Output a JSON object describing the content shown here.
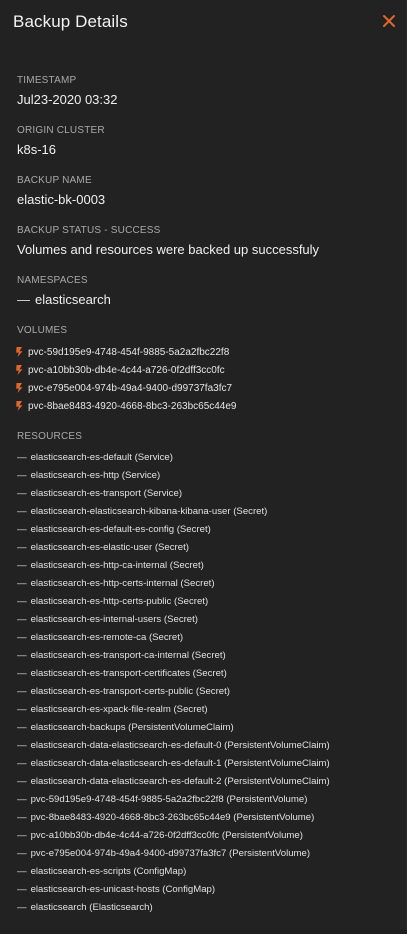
{
  "panel": {
    "title": "Backup Details",
    "close_label": "×"
  },
  "colors": {
    "background": "#222222",
    "accent": "#e0662b",
    "label": "#a9a9a9",
    "text": "#f0f0f0"
  },
  "timestamp": {
    "label": "TIMESTAMP",
    "value": "Jul23-2020 03:32"
  },
  "origin_cluster": {
    "label": "ORIGIN CLUSTER",
    "value": "k8s-16"
  },
  "backup_name": {
    "label": "BACKUP NAME",
    "value": "elastic-bk-0003"
  },
  "backup_status": {
    "label": "BACKUP STATUS - SUCCESS",
    "value": "Volumes and resources were backed up successfuly"
  },
  "namespaces": {
    "label": "NAMESPACES",
    "items": [
      "elasticsearch"
    ]
  },
  "volumes": {
    "label": "VOLUMES",
    "icon": "storage-volume-icon",
    "items": [
      "pvc-59d195e9-4748-454f-9885-5a2a2fbc22f8",
      "pvc-a10bb30b-db4e-4c44-a726-0f2dff3cc0fc",
      "pvc-e795e004-974b-49a4-9400-d99737fa3fc7",
      "pvc-8bae8483-4920-4668-8bc3-263bc65c44e9"
    ]
  },
  "resources": {
    "label": "RESOURCES",
    "items": [
      "elasticsearch-es-default (Service)",
      "elasticsearch-es-http (Service)",
      "elasticsearch-es-transport (Service)",
      "elasticsearch-elasticsearch-kibana-kibana-user (Secret)",
      "elasticsearch-es-default-es-config (Secret)",
      "elasticsearch-es-elastic-user (Secret)",
      "elasticsearch-es-http-ca-internal (Secret)",
      "elasticsearch-es-http-certs-internal (Secret)",
      "elasticsearch-es-http-certs-public (Secret)",
      "elasticsearch-es-internal-users (Secret)",
      "elasticsearch-es-remote-ca (Secret)",
      "elasticsearch-es-transport-ca-internal (Secret)",
      "elasticsearch-es-transport-certificates (Secret)",
      "elasticsearch-es-transport-certs-public (Secret)",
      "elasticsearch-es-xpack-file-realm (Secret)",
      "elasticsearch-backups (PersistentVolumeClaim)",
      "elasticsearch-data-elasticsearch-es-default-0 (PersistentVolumeClaim)",
      "elasticsearch-data-elasticsearch-es-default-1 (PersistentVolumeClaim)",
      "elasticsearch-data-elasticsearch-es-default-2 (PersistentVolumeClaim)",
      "pvc-59d195e9-4748-454f-9885-5a2a2fbc22f8 (PersistentVolume)",
      "pvc-8bae8483-4920-4668-8bc3-263bc65c44e9 (PersistentVolume)",
      "pvc-a10bb30b-db4e-4c44-a726-0f2dff3cc0fc (PersistentVolume)",
      "pvc-e795e004-974b-49a4-9400-d99737fa3fc7 (PersistentVolume)",
      "elasticsearch-es-scripts (ConfigMap)",
      "elasticsearch-es-unicast-hosts (ConfigMap)",
      "elasticsearch (Elasticsearch)"
    ]
  }
}
